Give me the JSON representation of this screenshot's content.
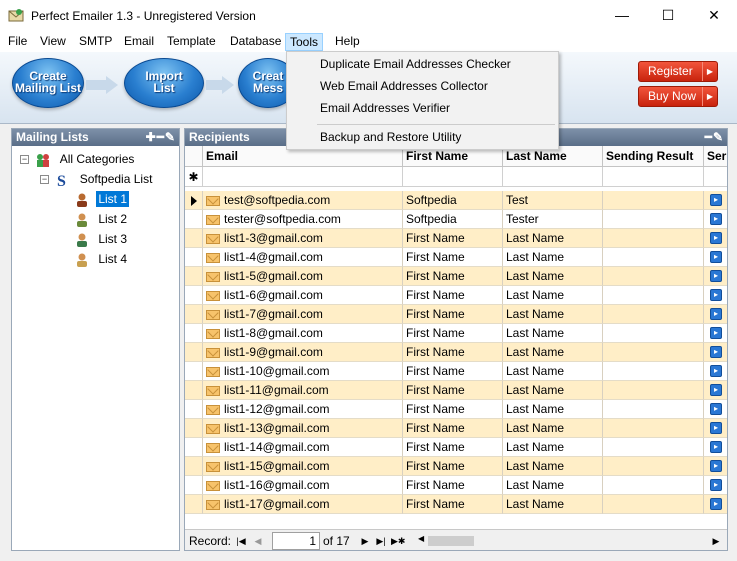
{
  "window": {
    "title": "Perfect Emailer 1.3 - Unregistered Version",
    "minimize": "—",
    "maximize": "☐",
    "close": "✕"
  },
  "menu": [
    "File",
    "View",
    "SMTP",
    "Email",
    "Template",
    "Database",
    "Tools",
    "Help"
  ],
  "tools_menu": {
    "items": [
      "Duplicate Email Addresses Checker",
      "Web Email Addresses Collector",
      "Email Addresses Verifier"
    ],
    "after_separator": "Backup and Restore Utility"
  },
  "toolbar": {
    "create_label_1": "Create",
    "create_label_2": "Mailing List",
    "import_label_1": "Import",
    "import_label_2": "List",
    "create_msg_label_1": "Creat",
    "create_msg_label_2": "Mess",
    "register": "Register",
    "buy_now": "Buy Now"
  },
  "left_panel": {
    "title": "Mailing Lists",
    "tools": "✚━✎",
    "tree": {
      "root": "All Categories",
      "group": "Softpedia List",
      "lists": [
        "List 1",
        "List 2",
        "List 3",
        "List 4"
      ]
    }
  },
  "recipients": {
    "title": "Recipients",
    "tools": "━✎",
    "columns": [
      "Email",
      "First Name",
      "Last Name",
      "Sending Result",
      "Ser"
    ],
    "new_row_marker": "✱",
    "rows": [
      {
        "email": "test@softpedia.com",
        "first": "Softpedia",
        "last": "Test"
      },
      {
        "email": "tester@softpedia.com",
        "first": "Softpedia",
        "last": "Tester"
      },
      {
        "email": "list1-3@gmail.com",
        "first": "First Name",
        "last": "Last Name"
      },
      {
        "email": "list1-4@gmail.com",
        "first": "First Name",
        "last": "Last Name"
      },
      {
        "email": "list1-5@gmail.com",
        "first": "First Name",
        "last": "Last Name"
      },
      {
        "email": "list1-6@gmail.com",
        "first": "First Name",
        "last": "Last Name"
      },
      {
        "email": "list1-7@gmail.com",
        "first": "First Name",
        "last": "Last Name"
      },
      {
        "email": "list1-8@gmail.com",
        "first": "First Name",
        "last": "Last Name"
      },
      {
        "email": "list1-9@gmail.com",
        "first": "First Name",
        "last": "Last Name"
      },
      {
        "email": "list1-10@gmail.com",
        "first": "First Name",
        "last": "Last Name"
      },
      {
        "email": "list1-11@gmail.com",
        "first": "First Name",
        "last": "Last Name"
      },
      {
        "email": "list1-12@gmail.com",
        "first": "First Name",
        "last": "Last Name"
      },
      {
        "email": "list1-13@gmail.com",
        "first": "First Name",
        "last": "Last Name"
      },
      {
        "email": "list1-14@gmail.com",
        "first": "First Name",
        "last": "Last Name"
      },
      {
        "email": "list1-15@gmail.com",
        "first": "First Name",
        "last": "Last Name"
      },
      {
        "email": "list1-16@gmail.com",
        "first": "First Name",
        "last": "Last Name"
      },
      {
        "email": "list1-17@gmail.com",
        "first": "First Name",
        "last": "Last Name"
      }
    ]
  },
  "record_nav": {
    "label": "Record:",
    "current": "1",
    "of_total": "of 17"
  }
}
